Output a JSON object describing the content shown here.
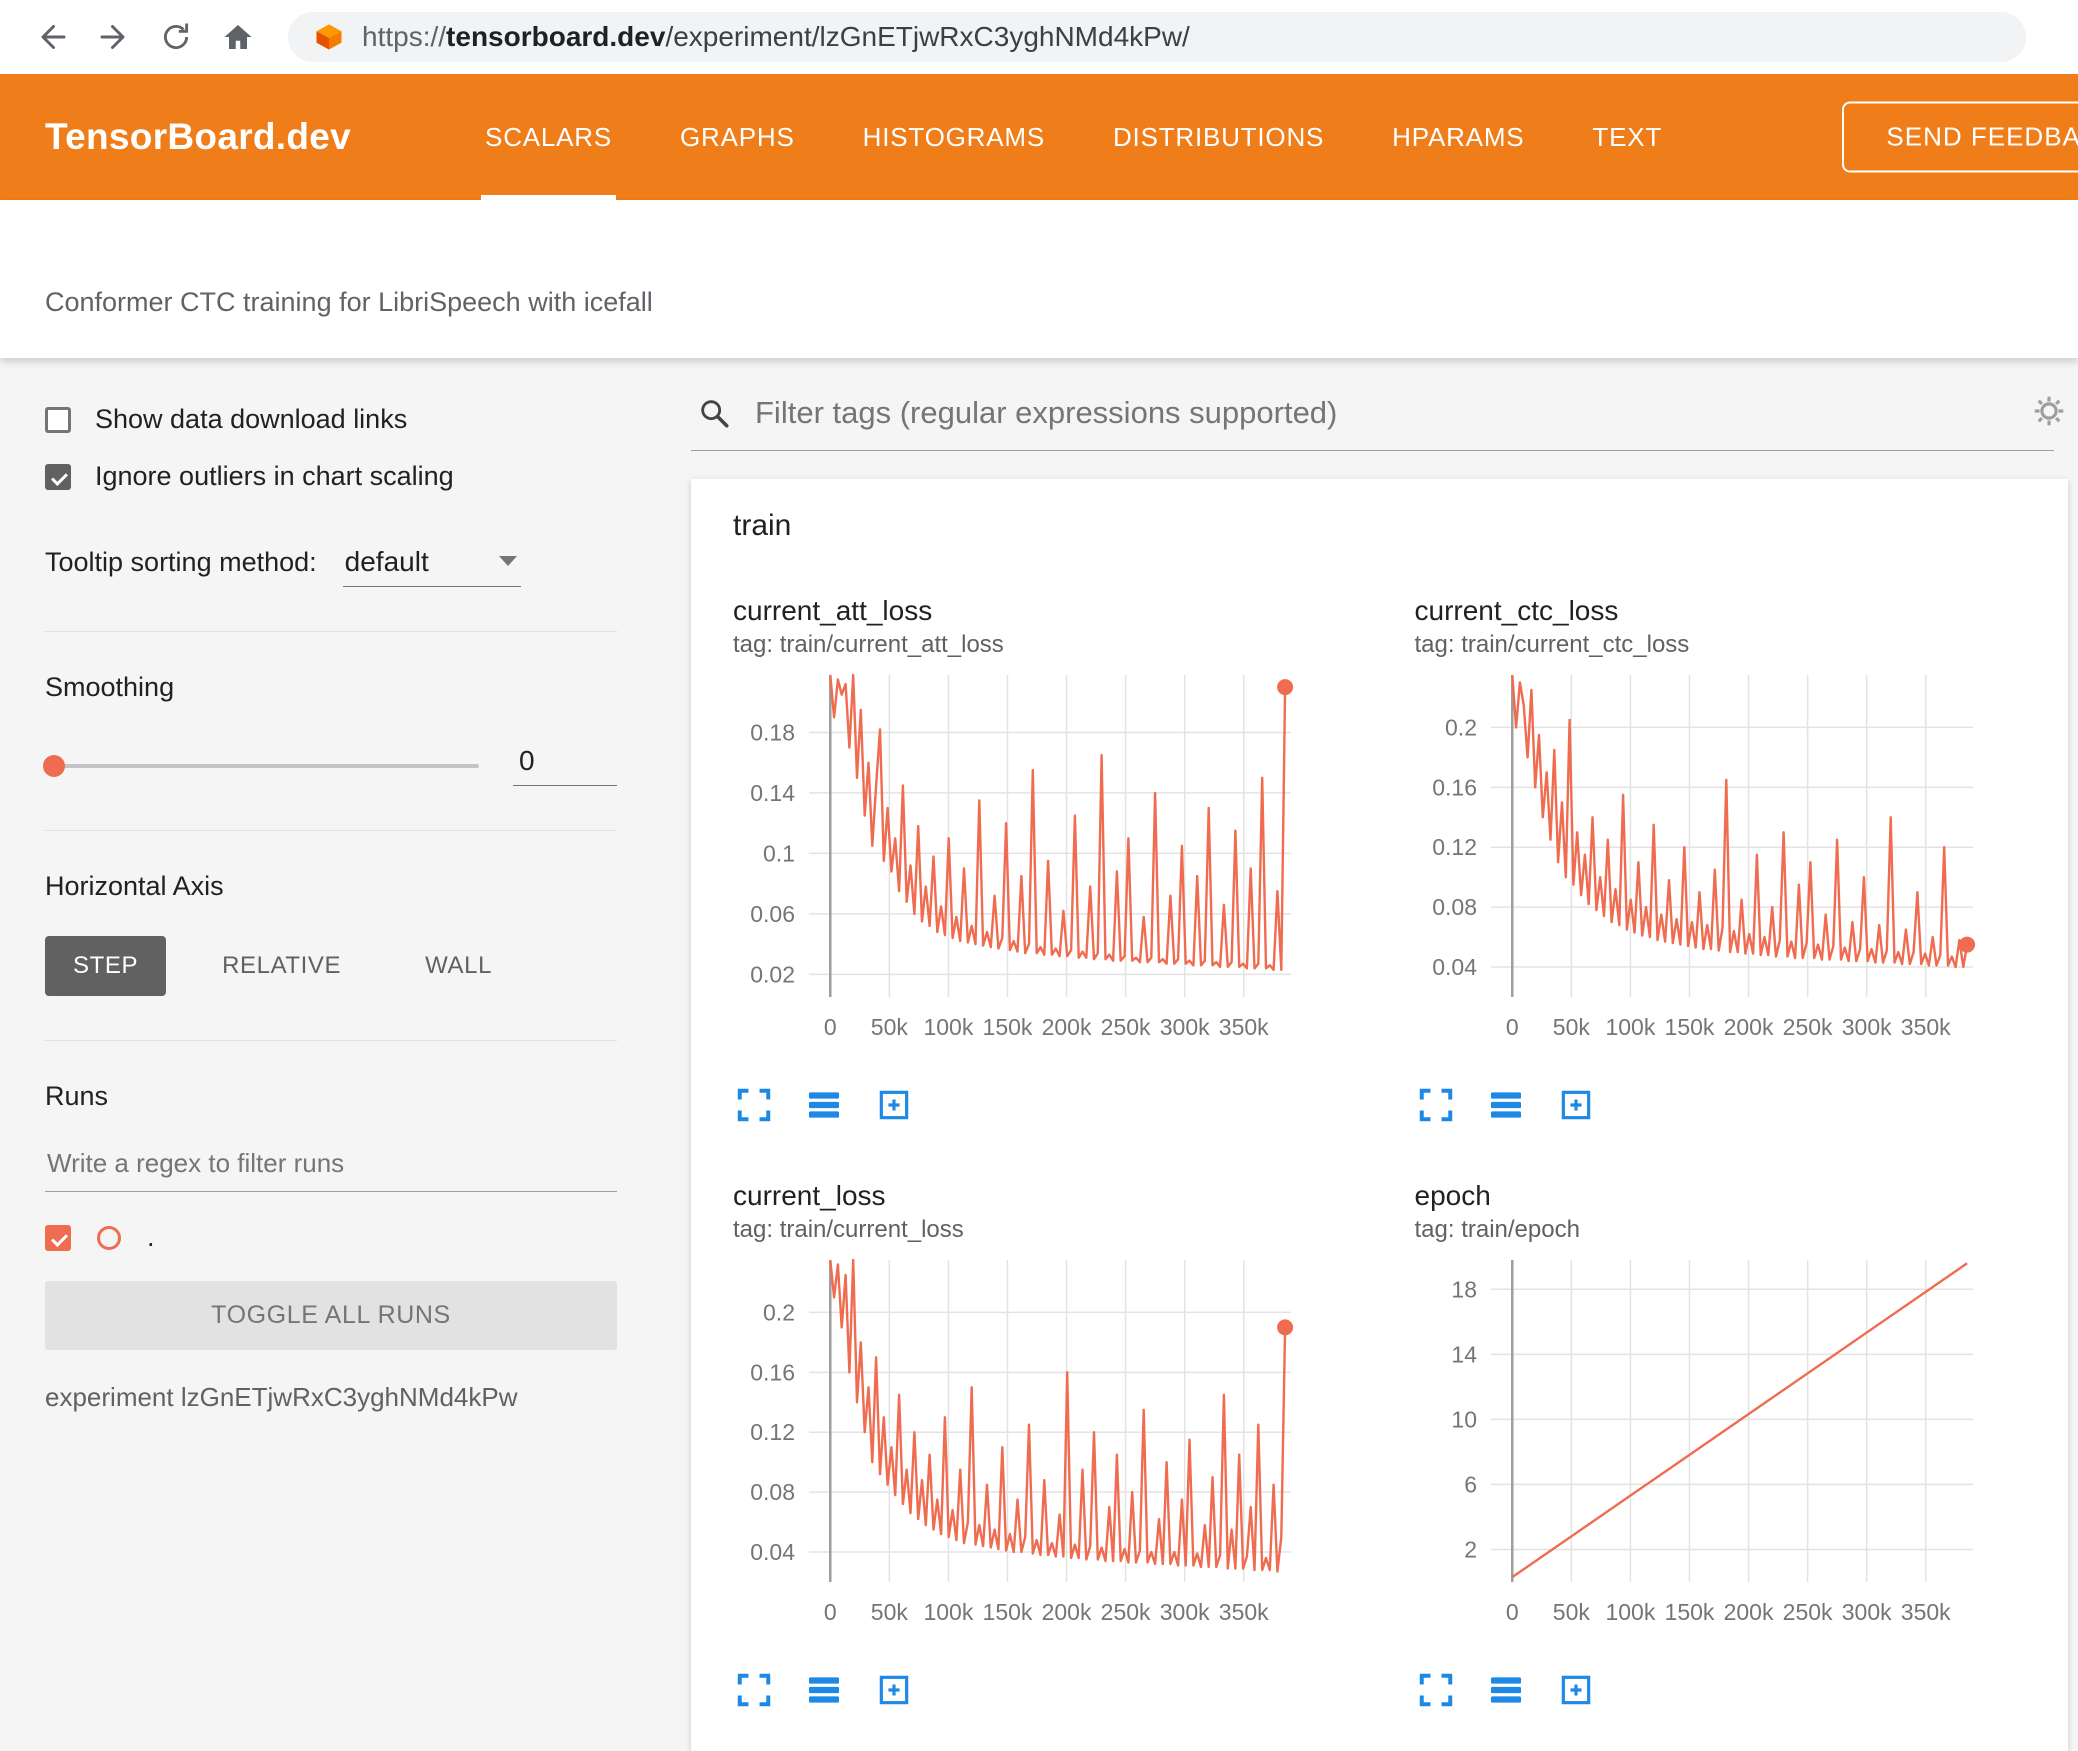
{
  "browser": {
    "url_scheme": "https://",
    "url_domain": "tensorboard.dev",
    "url_path": "/experiment/lzGnETjwRxC3yghNMd4kPw/"
  },
  "icons": {
    "back": "back-arrow",
    "forward": "forward-arrow",
    "reload": "reload-circle",
    "home": "home-house",
    "favicon": "tensorboard-logo",
    "search": "magnifier",
    "settings": "gear",
    "chart_tools": [
      "expand-fullscreen",
      "data-lines",
      "fit-domain"
    ]
  },
  "header": {
    "logo": "TensorBoard.dev",
    "tabs": [
      {
        "label": "SCALARS",
        "active": true
      },
      {
        "label": "GRAPHS",
        "active": false
      },
      {
        "label": "HISTOGRAMS",
        "active": false
      },
      {
        "label": "DISTRIBUTIONS",
        "active": false
      },
      {
        "label": "HPARAMS",
        "active": false
      },
      {
        "label": "TEXT",
        "active": false
      }
    ],
    "feedback_label": "SEND FEEDBACK"
  },
  "subheader": {
    "title": "Conformer CTC training for LibriSpeech with icefall"
  },
  "sidebar": {
    "show_download_label": "Show data download links",
    "show_download_checked": false,
    "ignore_outliers_label": "Ignore outliers in chart scaling",
    "ignore_outliers_checked": true,
    "tooltip_label": "Tooltip sorting method:",
    "tooltip_value": "default",
    "smoothing_label": "Smoothing",
    "smoothing_value": "0",
    "haxis_label": "Horizontal Axis",
    "haxis_options": [
      "STEP",
      "RELATIVE",
      "WALL"
    ],
    "haxis_selected": "STEP",
    "runs_label": "Runs",
    "runs_placeholder": "Write a regex to filter runs",
    "run_name": ".",
    "run_checked": true,
    "toggle_all_label": "TOGGLE ALL RUNS",
    "experiment_caption": "experiment lzGnETjwRxC3yghNMd4kPw"
  },
  "main": {
    "filter_placeholder": "Filter tags (regular expressions supported)",
    "group_title": "train"
  },
  "colors": {
    "header_orange": "#ef7d1a",
    "run": "#ef6c50",
    "tool_icon_blue": "#1e88e5",
    "grid": "#e3e3e3",
    "zero_line": "#9e9e9e",
    "tick_text": "#757575"
  },
  "chart_data": [
    {
      "type": "line",
      "title": "current_att_loss",
      "tag": "tag: train/current_att_loss",
      "legend_position": "none",
      "grid": true,
      "x_start": 0,
      "x_end": 385000,
      "x_domain": [
        -18000,
        390000
      ],
      "x_ticks": [
        0,
        50000,
        100000,
        150000,
        200000,
        250000,
        300000,
        350000
      ],
      "x_tick_labels": [
        "0",
        "50k",
        "100k",
        "150k",
        "200k",
        "250k",
        "300k",
        "350k"
      ],
      "y_ticks": [
        0.02,
        0.06,
        0.1,
        0.14,
        0.18
      ],
      "y_tick_labels": [
        "0.02",
        "0.06",
        "0.1",
        "0.14",
        "0.18"
      ],
      "y_domain": [
        0.005,
        0.218
      ],
      "end_dot": true,
      "values": [
        0.218,
        0.19,
        0.215,
        0.205,
        0.212,
        0.17,
        0.218,
        0.15,
        0.195,
        0.125,
        0.16,
        0.105,
        0.145,
        0.182,
        0.095,
        0.13,
        0.088,
        0.11,
        0.075,
        0.145,
        0.068,
        0.092,
        0.06,
        0.118,
        0.055,
        0.078,
        0.052,
        0.098,
        0.048,
        0.065,
        0.046,
        0.11,
        0.044,
        0.058,
        0.042,
        0.09,
        0.041,
        0.052,
        0.04,
        0.135,
        0.039,
        0.048,
        0.038,
        0.072,
        0.037,
        0.044,
        0.12,
        0.036,
        0.042,
        0.035,
        0.085,
        0.034,
        0.04,
        0.155,
        0.034,
        0.038,
        0.033,
        0.095,
        0.033,
        0.037,
        0.032,
        0.062,
        0.032,
        0.036,
        0.125,
        0.031,
        0.035,
        0.031,
        0.078,
        0.03,
        0.034,
        0.165,
        0.03,
        0.033,
        0.029,
        0.088,
        0.029,
        0.032,
        0.11,
        0.029,
        0.031,
        0.028,
        0.058,
        0.028,
        0.031,
        0.14,
        0.028,
        0.03,
        0.027,
        0.072,
        0.027,
        0.03,
        0.105,
        0.027,
        0.029,
        0.026,
        0.085,
        0.026,
        0.029,
        0.13,
        0.026,
        0.028,
        0.025,
        0.066,
        0.025,
        0.028,
        0.115,
        0.025,
        0.027,
        0.024,
        0.09,
        0.024,
        0.027,
        0.15,
        0.024,
        0.026,
        0.023,
        0.075,
        0.023,
        0.21
      ]
    },
    {
      "type": "line",
      "title": "current_ctc_loss",
      "tag": "tag: train/current_ctc_loss",
      "legend_position": "none",
      "grid": true,
      "x_start": 0,
      "x_end": 385000,
      "x_domain": [
        -18000,
        390000
      ],
      "x_ticks": [
        0,
        50000,
        100000,
        150000,
        200000,
        250000,
        300000,
        350000
      ],
      "x_tick_labels": [
        "0",
        "50k",
        "100k",
        "150k",
        "200k",
        "250k",
        "300k",
        "350k"
      ],
      "y_ticks": [
        0.04,
        0.08,
        0.12,
        0.16,
        0.2
      ],
      "y_tick_labels": [
        "0.04",
        "0.08",
        "0.12",
        "0.16",
        "0.2"
      ],
      "y_domain": [
        0.02,
        0.235
      ],
      "end_dot": true,
      "values": [
        0.235,
        0.2,
        0.23,
        0.215,
        0.18,
        0.225,
        0.16,
        0.195,
        0.14,
        0.17,
        0.125,
        0.185,
        0.11,
        0.15,
        0.1,
        0.205,
        0.095,
        0.13,
        0.088,
        0.115,
        0.082,
        0.14,
        0.078,
        0.1,
        0.074,
        0.125,
        0.07,
        0.092,
        0.068,
        0.155,
        0.065,
        0.085,
        0.063,
        0.11,
        0.061,
        0.08,
        0.06,
        0.135,
        0.058,
        0.075,
        0.057,
        0.098,
        0.056,
        0.072,
        0.055,
        0.12,
        0.054,
        0.07,
        0.053,
        0.09,
        0.052,
        0.068,
        0.052,
        0.105,
        0.051,
        0.066,
        0.165,
        0.05,
        0.064,
        0.05,
        0.085,
        0.049,
        0.062,
        0.049,
        0.115,
        0.048,
        0.06,
        0.048,
        0.08,
        0.047,
        0.058,
        0.13,
        0.047,
        0.057,
        0.046,
        0.095,
        0.046,
        0.056,
        0.11,
        0.046,
        0.055,
        0.045,
        0.075,
        0.045,
        0.054,
        0.125,
        0.045,
        0.053,
        0.044,
        0.07,
        0.044,
        0.052,
        0.1,
        0.044,
        0.052,
        0.043,
        0.068,
        0.043,
        0.051,
        0.14,
        0.043,
        0.05,
        0.042,
        0.065,
        0.042,
        0.05,
        0.09,
        0.042,
        0.049,
        0.041,
        0.06,
        0.041,
        0.048,
        0.12,
        0.041,
        0.047,
        0.04,
        0.058,
        0.04,
        0.055
      ]
    },
    {
      "type": "line",
      "title": "current_loss",
      "tag": "tag: train/current_loss",
      "legend_position": "none",
      "grid": true,
      "x_start": 0,
      "x_end": 385000,
      "x_domain": [
        -18000,
        390000
      ],
      "x_ticks": [
        0,
        50000,
        100000,
        150000,
        200000,
        250000,
        300000,
        350000
      ],
      "x_tick_labels": [
        "0",
        "50k",
        "100k",
        "150k",
        "200k",
        "250k",
        "300k",
        "350k"
      ],
      "y_ticks": [
        0.04,
        0.08,
        0.12,
        0.16,
        0.2
      ],
      "y_tick_labels": [
        "0.04",
        "0.08",
        "0.12",
        "0.16",
        "0.2"
      ],
      "y_domain": [
        0.02,
        0.235
      ],
      "end_dot": true,
      "values": [
        0.235,
        0.21,
        0.232,
        0.19,
        0.225,
        0.16,
        0.235,
        0.14,
        0.18,
        0.12,
        0.15,
        0.1,
        0.17,
        0.092,
        0.13,
        0.085,
        0.11,
        0.078,
        0.145,
        0.072,
        0.095,
        0.066,
        0.12,
        0.062,
        0.088,
        0.058,
        0.105,
        0.055,
        0.075,
        0.052,
        0.13,
        0.05,
        0.068,
        0.048,
        0.095,
        0.046,
        0.06,
        0.15,
        0.045,
        0.058,
        0.044,
        0.085,
        0.043,
        0.055,
        0.042,
        0.11,
        0.041,
        0.052,
        0.04,
        0.075,
        0.04,
        0.05,
        0.125,
        0.039,
        0.048,
        0.038,
        0.088,
        0.038,
        0.046,
        0.037,
        0.065,
        0.037,
        0.16,
        0.036,
        0.045,
        0.036,
        0.095,
        0.035,
        0.044,
        0.12,
        0.035,
        0.043,
        0.034,
        0.07,
        0.034,
        0.105,
        0.034,
        0.042,
        0.033,
        0.08,
        0.033,
        0.041,
        0.135,
        0.033,
        0.04,
        0.032,
        0.062,
        0.032,
        0.1,
        0.032,
        0.04,
        0.031,
        0.075,
        0.031,
        0.115,
        0.031,
        0.039,
        0.03,
        0.058,
        0.03,
        0.09,
        0.03,
        0.038,
        0.145,
        0.029,
        0.055,
        0.029,
        0.105,
        0.029,
        0.037,
        0.07,
        0.028,
        0.125,
        0.028,
        0.036,
        0.028,
        0.085,
        0.027,
        0.05,
        0.19
      ]
    },
    {
      "type": "line",
      "title": "epoch",
      "tag": "tag: train/epoch",
      "legend_position": "none",
      "grid": true,
      "x": [
        0,
        385000
      ],
      "x_domain": [
        -18000,
        390000
      ],
      "x_ticks": [
        0,
        50000,
        100000,
        150000,
        200000,
        250000,
        300000,
        350000
      ],
      "x_tick_labels": [
        "0",
        "50k",
        "100k",
        "150k",
        "200k",
        "250k",
        "300k",
        "350k"
      ],
      "y_ticks": [
        2,
        6,
        10,
        14,
        18
      ],
      "y_tick_labels": [
        "2",
        "6",
        "10",
        "14",
        "18"
      ],
      "y_domain": [
        0,
        19.8
      ],
      "end_dot": false,
      "values": [
        0.3,
        19.6
      ]
    }
  ]
}
